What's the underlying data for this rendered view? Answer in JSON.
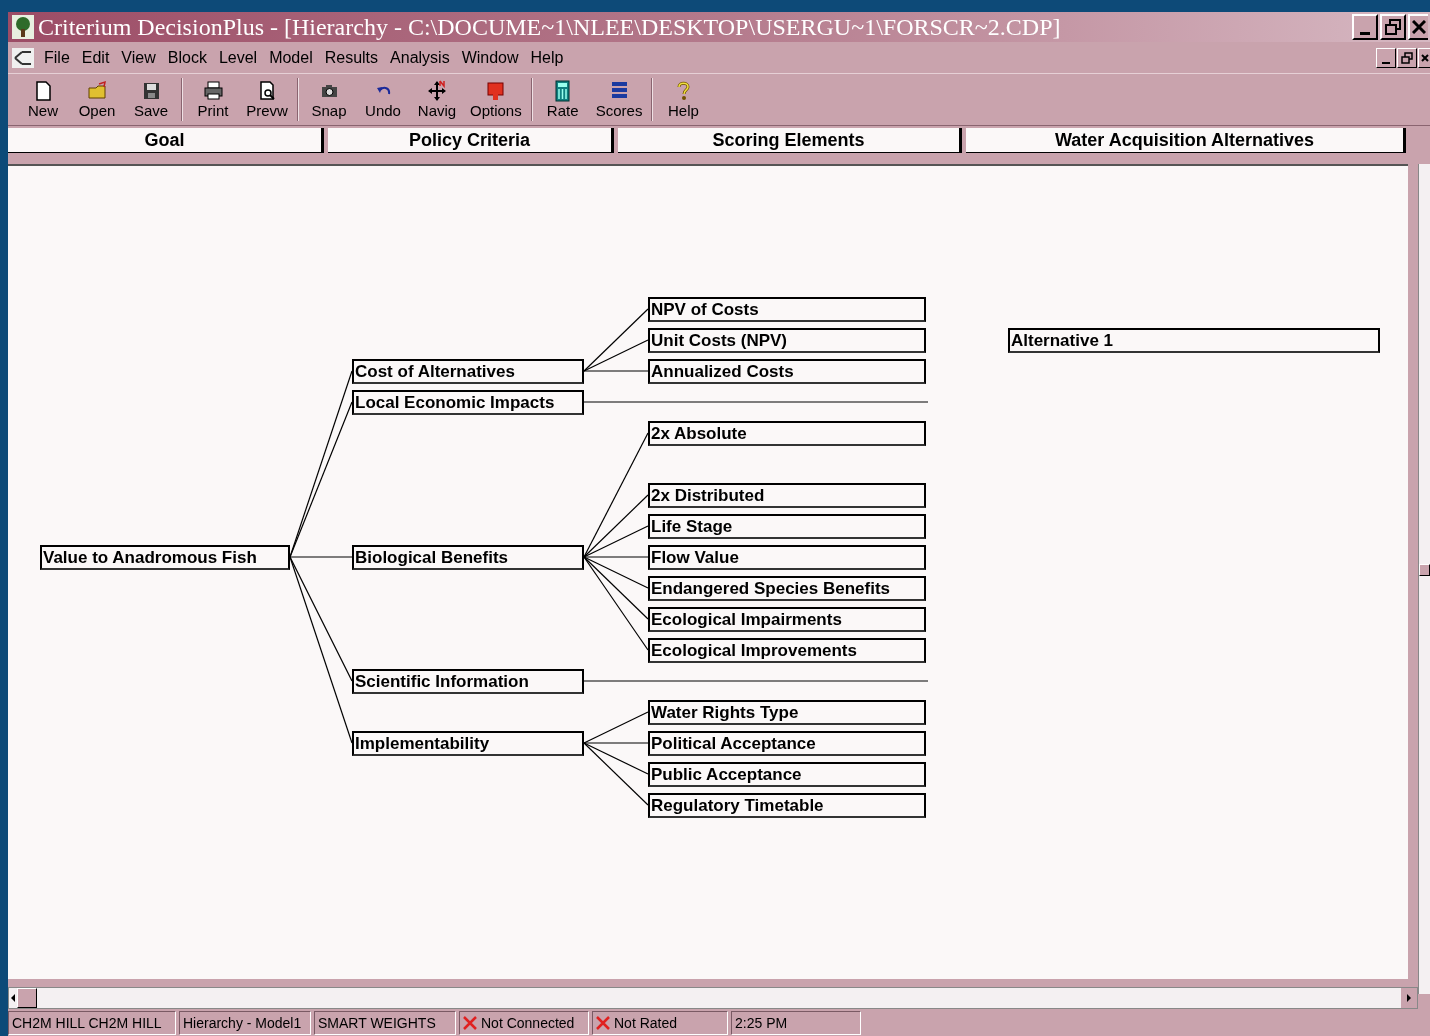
{
  "window": {
    "title": "Criterium DecisionPlus - [Hierarchy - C:\\DOCUME~1\\NLEE\\DESKTOP\\USERGU~1\\FORSCR~2.CDP]"
  },
  "menu": [
    "File",
    "Edit",
    "View",
    "Block",
    "Level",
    "Model",
    "Results",
    "Analysis",
    "Window",
    "Help"
  ],
  "toolbar": [
    {
      "label": "New"
    },
    {
      "label": "Open"
    },
    {
      "label": "Save"
    },
    {
      "label": "Print"
    },
    {
      "label": "Prevw"
    },
    {
      "label": "Snap"
    },
    {
      "label": "Undo"
    },
    {
      "label": "Navig"
    },
    {
      "label": "Options"
    },
    {
      "label": "Rate"
    },
    {
      "label": "Scores"
    },
    {
      "label": "Help"
    }
  ],
  "columns": [
    "Goal",
    "Policy Criteria",
    "Scoring Elements",
    "Water Acquisition Alternatives"
  ],
  "hierarchy": {
    "goal": {
      "label": "Value to Anadromous Fish",
      "children": [
        {
          "label": "Cost of Alternatives",
          "children": [
            {
              "label": "NPV of Costs"
            },
            {
              "label": "Unit Costs (NPV)"
            },
            {
              "label": "Annualized Costs"
            }
          ]
        },
        {
          "label": "Local Economic Impacts"
        },
        {
          "label": "Biological Benefits",
          "children": [
            {
              "label": "2x Absolute"
            },
            {
              "label": "2x Distributed"
            },
            {
              "label": "Life Stage"
            },
            {
              "label": "Flow Value"
            },
            {
              "label": "Endangered Species Benefits"
            },
            {
              "label": "Ecological Impairments"
            },
            {
              "label": "Ecological Improvements"
            }
          ]
        },
        {
          "label": "Scientific Information"
        },
        {
          "label": "Implementability",
          "children": [
            {
              "label": "Water Rights Type"
            },
            {
              "label": "Political Acceptance"
            },
            {
              "label": "Public Acceptance"
            },
            {
              "label": "Regulatory Timetable"
            }
          ]
        }
      ]
    },
    "alternatives": [
      {
        "label": "Alternative 1"
      }
    ]
  },
  "status_bar": [
    {
      "text": "CH2M HILL CH2M HILL",
      "kind": "plain"
    },
    {
      "text": "Hierarchy - Model1",
      "kind": "plain"
    },
    {
      "text": "SMART  WEIGHTS",
      "kind": "plain"
    },
    {
      "text": "Not Connected",
      "kind": "error"
    },
    {
      "text": "Not Rated",
      "kind": "error"
    },
    {
      "text": "2:25 PM",
      "kind": "plain"
    }
  ]
}
